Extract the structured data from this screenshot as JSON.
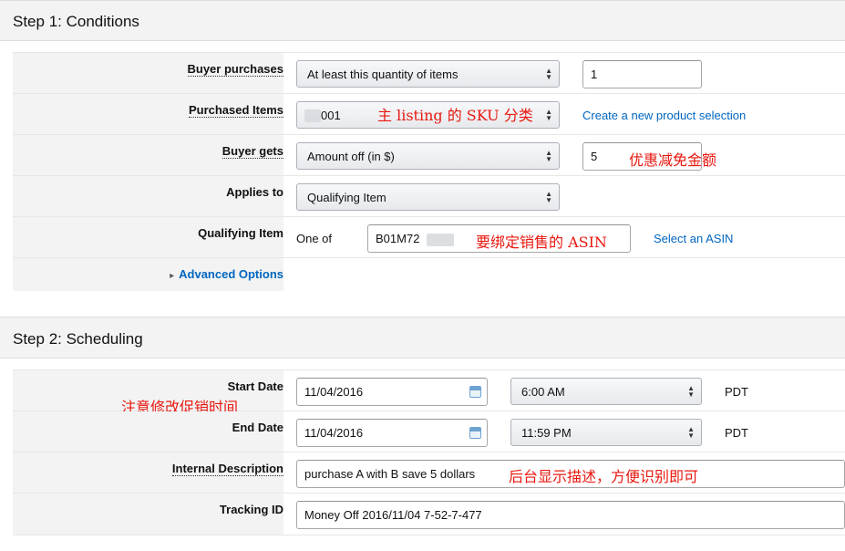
{
  "step1": {
    "title": "Step 1: Conditions",
    "buyer_purchases": {
      "label": "Buyer purchases",
      "select": "At least this quantity of items",
      "quantity": "1"
    },
    "purchased_items": {
      "label": "Purchased Items",
      "select": "001",
      "link": "Create a new product selection",
      "annotation": "主 listing 的 SKU 分类"
    },
    "buyer_gets": {
      "label": "Buyer gets",
      "select": "Amount off (in $)",
      "amount": "5",
      "annotation": "优惠减免金额"
    },
    "applies_to": {
      "label": "Applies to",
      "select": "Qualifying Item"
    },
    "qualifying_item": {
      "label": "Qualifying Item",
      "prefix": "One of",
      "asin": "B01M72",
      "link": "Select an ASIN",
      "annotation": "要绑定销售的 ASIN"
    },
    "advanced": {
      "label": "Advanced Options",
      "arrow": "▸"
    }
  },
  "step2": {
    "title": "Step 2: Scheduling",
    "start_date": {
      "label": "Start Date",
      "date": "11/04/2016",
      "time": "6:00 AM",
      "tz": "PDT",
      "annotation": "注意修改促销时间"
    },
    "end_date": {
      "label": "End Date",
      "date": "11/04/2016",
      "time": "11:59 PM",
      "tz": "PDT"
    },
    "internal_description": {
      "label": "Internal Description",
      "value": "purchase A with B save 5 dollars",
      "annotation": "后台显示描述，方便识别即可"
    },
    "tracking_id": {
      "label": "Tracking ID",
      "value": "Money Off 2016/11/04 7-52-7-477"
    }
  },
  "colors": {
    "link": "#0066c0",
    "annotation": "#e8170f",
    "header_bg": "#f3f3f3"
  }
}
